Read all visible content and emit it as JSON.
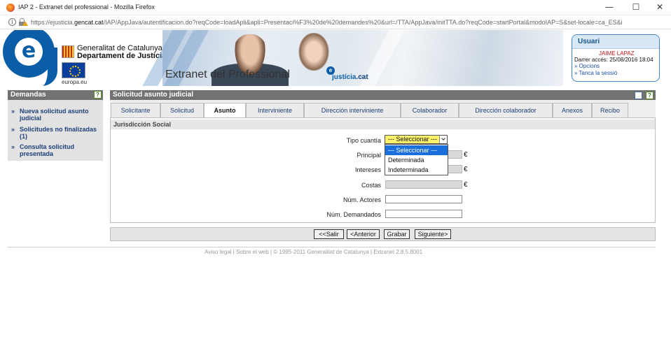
{
  "window": {
    "title": "IAP 2 - Extranet del professional - Mozilla Firefox",
    "minimize_glyph": "—",
    "maximize_glyph": "☐",
    "close_glyph": "✕"
  },
  "browser": {
    "url_prefix": "https://ejusticia.",
    "url_domain": "gencat.cat",
    "url_rest": "/IAP/AppJava/autentificacion.do?reqCode=loadApli&apli=Presentaci%F3%20de%20demandes%20&url=/TTA/AppJava/initTTA.do?reqCode=startPortal&modoIAP=S&set-locale=ca_ES&i"
  },
  "banner": {
    "gencat_name": "Generalitat de Catalunya",
    "gencat_dept": "Departament de Justícia",
    "eu_label": "europa.eu",
    "title": "Extranet del Professional",
    "justicia_e": "e",
    "justicia_name": "justícia",
    "justicia_tld": ".cat"
  },
  "user_box": {
    "title": "Usuari",
    "name": "JAIME LAPAZ",
    "last_access": "Darrer accés: 25/08/2016 18:04",
    "options": "» Opcions",
    "logout": "» Tanca la sessió"
  },
  "sidebar": {
    "title": "Demandas",
    "help": "?",
    "items": [
      {
        "arrow": "»",
        "label": "Nueva solicitud asunto judicial"
      },
      {
        "arrow": "»",
        "label": "Solicitudes no finalizadas (1)"
      },
      {
        "arrow": "»",
        "label": "Consulta solicitud presentada"
      }
    ]
  },
  "main": {
    "title": "Solicitud asunto judicial",
    "help": "?",
    "tabs": [
      {
        "label": "Solicitante"
      },
      {
        "label": "Solicitud"
      },
      {
        "label": "Asunto"
      },
      {
        "label": "Interviniente"
      },
      {
        "label": "Dirección interviniente"
      },
      {
        "label": "Colaborador"
      },
      {
        "label": "Dirección colaborador"
      },
      {
        "label": "Anexos"
      },
      {
        "label": "Recibo"
      }
    ],
    "active_tab": "Asunto",
    "section": "Jurisdicción Social",
    "form": {
      "tipo_cuantia_label": "Tipo cuantía",
      "tipo_cuantia_value": "--- Seleccionar ---",
      "tipo_cuantia_options": [
        "--- Seleccionar ---",
        "Determinada",
        "Indeterminada"
      ],
      "principal_label": "Principal",
      "intereses_label": "Intereses",
      "costas_label": "Costas",
      "actores_label": "Núm. Actores",
      "demandados_label": "Núm. Demandados",
      "currency": "€"
    },
    "buttons": {
      "salir": "<<Salir",
      "anterior": "<Anterior",
      "grabar": "Grabar",
      "siguiente": "Siguiente>"
    }
  },
  "footer": "Aviso legal |  Sobre el web |  © 1995-2011 Generalitat de Catalunya |  Extranet 2.8.5.8001"
}
